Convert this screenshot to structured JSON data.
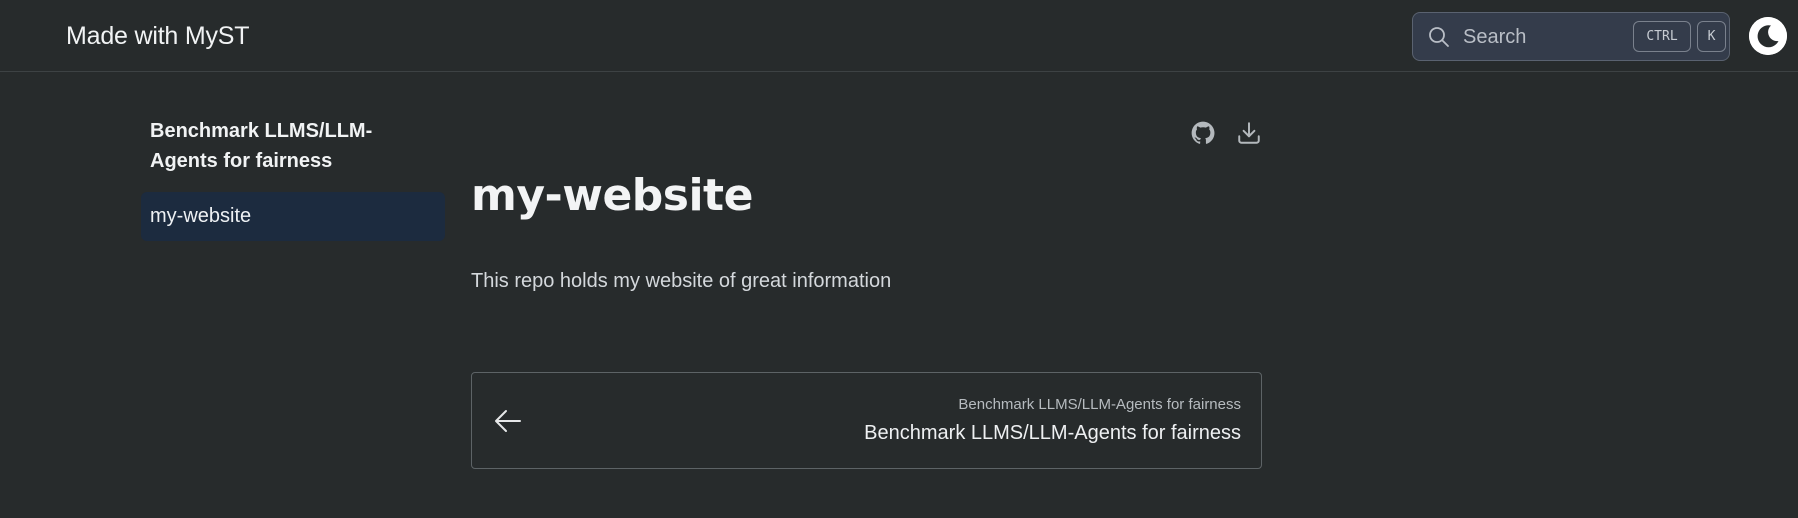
{
  "header": {
    "brand": "Made with MyST",
    "search": {
      "placeholder": "Search",
      "shortcut_keys": [
        "CTRL",
        "K"
      ]
    },
    "theme_toggle_icon": "moon-icon"
  },
  "sidebar": {
    "project_title": "Benchmark LLMS/LLM-Agents for fairness",
    "items": [
      {
        "label": "my-website",
        "active": true
      }
    ]
  },
  "page": {
    "actions": [
      {
        "icon": "github-icon"
      },
      {
        "icon": "download-icon"
      }
    ],
    "title": "my-website",
    "description": "This repo holds my website of great information"
  },
  "pager": {
    "prev": {
      "icon": "arrow-left-icon",
      "subtitle": "Benchmark LLMS/LLM-Agents for fairness",
      "title": "Benchmark LLMS/LLM-Agents for fairness"
    }
  },
  "colors": {
    "background": "#272b2c",
    "search_bg": "#343c4b",
    "active_nav_bg": "#1c2b3f"
  }
}
